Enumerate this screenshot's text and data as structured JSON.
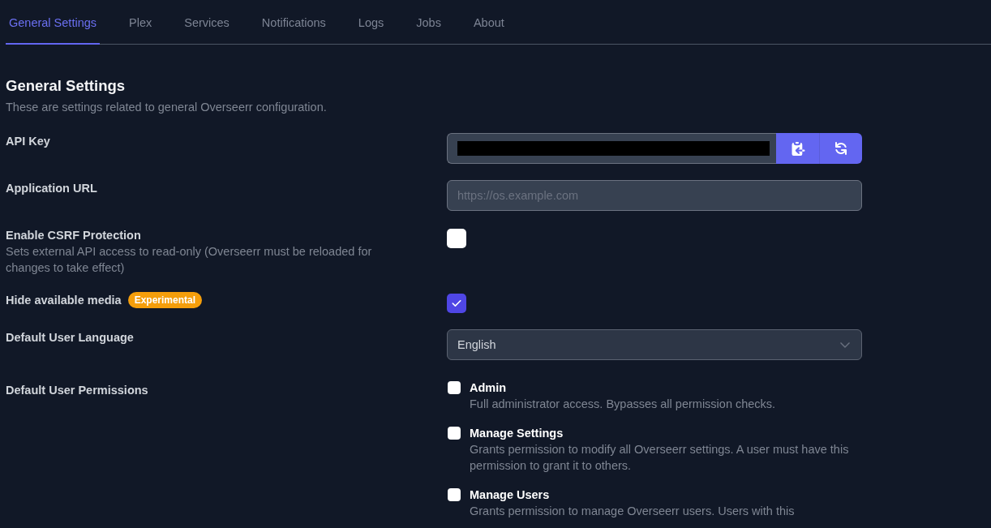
{
  "tabs": [
    {
      "label": "General Settings",
      "selected": true
    },
    {
      "label": "Plex",
      "selected": false
    },
    {
      "label": "Services",
      "selected": false
    },
    {
      "label": "Notifications",
      "selected": false
    },
    {
      "label": "Logs",
      "selected": false
    },
    {
      "label": "Jobs",
      "selected": false
    },
    {
      "label": "About",
      "selected": false
    }
  ],
  "section": {
    "title": "General Settings",
    "description": "These are settings related to general Overseerr configuration."
  },
  "settings": [
    {
      "kind": "secret",
      "label": "API Key",
      "redacted": true
    },
    {
      "kind": "text",
      "label": "Application URL",
      "placeholder": "https://os.example.com"
    },
    {
      "kind": "checkbox",
      "label": "Enable CSRF Protection",
      "description": "Sets external API access to read-only (Overseerr must be reloaded for changes to take effect)",
      "checked": false
    },
    {
      "kind": "checkbox",
      "label": "Hide available media",
      "badge": "Experimental",
      "checked": true
    },
    {
      "kind": "select",
      "label": "Default User Language",
      "value": "English"
    },
    {
      "kind": "permissions",
      "label": "Default User Permissions",
      "permissions": [
        {
          "name": "Admin",
          "description": "Full administrator access. Bypasses all permission checks.",
          "checked": false
        },
        {
          "name": "Manage Settings",
          "description": "Grants permission to modify all Overseerr settings. A user must have this permission to grant it to others.",
          "checked": false
        },
        {
          "name": "Manage Users",
          "description": "Grants permission to manage Overseerr users. Users with this",
          "checked": false
        }
      ]
    }
  ]
}
